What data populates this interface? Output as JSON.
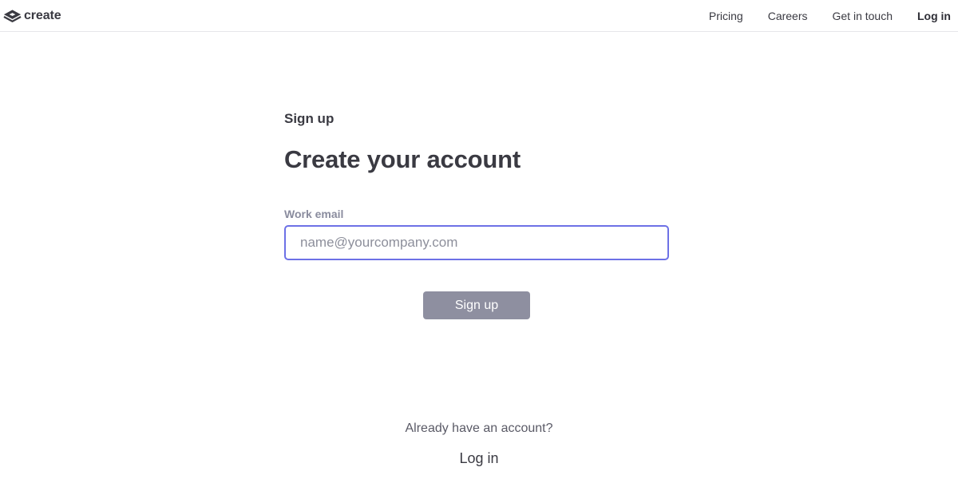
{
  "header": {
    "brand_name": "create",
    "logo_icon": "create-logo-icon",
    "nav": [
      {
        "label": "Pricing"
      },
      {
        "label": "Careers"
      },
      {
        "label": "Get in touch"
      },
      {
        "label": "Log in"
      }
    ]
  },
  "form": {
    "eyebrow": "Sign up",
    "title": "Create your account",
    "email_label": "Work email",
    "email_placeholder": "name@yourcompany.com",
    "email_value": "",
    "submit_label": "Sign up"
  },
  "footer": {
    "prompt": "Already have an account?",
    "login_label": "Log in"
  },
  "colors": {
    "text": "#3a3a42",
    "label": "#8a8c9e",
    "input_focus_border": "#6d71e6",
    "button_disabled_bg": "#8e8fa0",
    "divider": "#e6e6ea"
  }
}
